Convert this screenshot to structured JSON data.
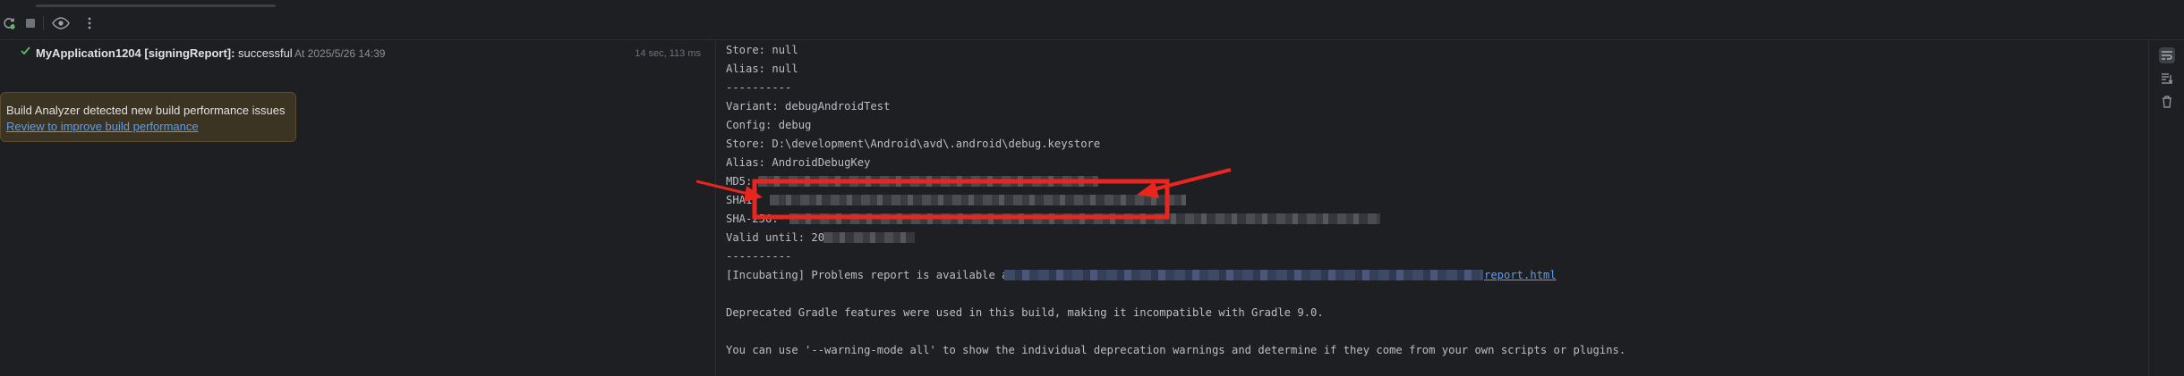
{
  "toolbar": {
    "icons": [
      "rerun-icon",
      "stop-icon",
      "eye-icon",
      "more-options-icon"
    ]
  },
  "build_tree": {
    "task_title": "MyApplication1204 [signingReport]:",
    "status": "successful",
    "time": "At 2025/5/26 14:39",
    "duration": "14 sec, 113 ms"
  },
  "notification": {
    "text": "Build Analyzer detected new build performance issues",
    "link": "Review to improve build performance"
  },
  "console": {
    "store_null": "Store: null",
    "alias_null": "Alias: null",
    "sep1": "----------",
    "variant": "Variant: debugAndroidTest",
    "config": "Config: debug",
    "store": "Store: D:\\development\\Android\\avd\\.android\\debug.keystore",
    "alias": "Alias: AndroidDebugKey",
    "md5": "MD5:",
    "sha1": "SHA1: ",
    "sha256": "SHA-256: ",
    "valid_until": "Valid until: 20",
    "sep2": "----------",
    "problems": "[Incubating] Problems report is available at:",
    "report_link": "report.html",
    "deprecated": "Deprecated Gradle features were used in this build, making it incompatible with Gradle 9.0.",
    "warning_mode": "You can use '--warning-mode all' to show the individual deprecation warnings and determine if they come from your own scripts or plugins."
  },
  "right_strip": {
    "icons": [
      "soft-wrap-icon",
      "scroll-to-end-icon",
      "clear-all-icon"
    ]
  },
  "colors": {
    "background": "#1e1f22",
    "success": "#5fb865",
    "link": "#589df6",
    "annotation": "#e8251f"
  }
}
